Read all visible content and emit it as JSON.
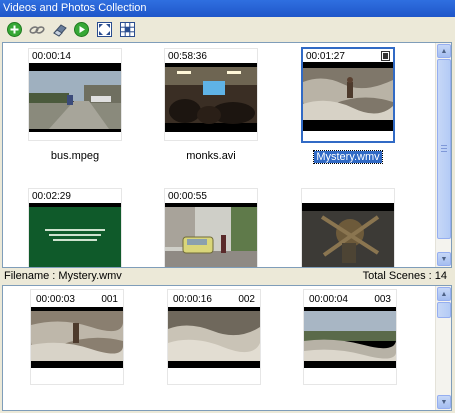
{
  "window": {
    "title": "Videos and Photos Collection"
  },
  "toolbar": {
    "buttons": [
      {
        "name": "add-icon",
        "color": "#2e9a2e"
      },
      {
        "name": "link-icon",
        "color": "#6b6b6b"
      },
      {
        "name": "eraser-icon",
        "color": "#5a6f8a"
      },
      {
        "name": "play-icon",
        "color": "#2e9a2e"
      },
      {
        "name": "fit-icon",
        "color": "#2a4d8f"
      },
      {
        "name": "grid-icon",
        "color": "#2a4d8f"
      }
    ]
  },
  "videos": [
    {
      "time": "00:00:14",
      "filename": "bus.mpeg",
      "selected": false
    },
    {
      "time": "00:58:36",
      "filename": "monks.avi",
      "selected": false
    },
    {
      "time": "00:01:27",
      "filename": "Mystery.wmv",
      "selected": true,
      "badge": "film-icon"
    },
    {
      "time": "00:02:29",
      "filename": "",
      "selected": false
    },
    {
      "time": "00:00:55",
      "filename": "",
      "selected": false
    },
    {
      "time": "",
      "filename": "",
      "selected": false
    }
  ],
  "status": {
    "filename_label": "Filename : Mystery.wmv",
    "scenes_label": "Total Scenes : 14"
  },
  "scenes": [
    {
      "time": "00:00:03",
      "number": "001"
    },
    {
      "time": "00:00:16",
      "number": "002"
    },
    {
      "time": "00:00:04",
      "number": "003"
    }
  ],
  "colors": {
    "title_bar": "#2463d6",
    "selection": "#316ac5",
    "pane_border": "#7f9db9"
  }
}
